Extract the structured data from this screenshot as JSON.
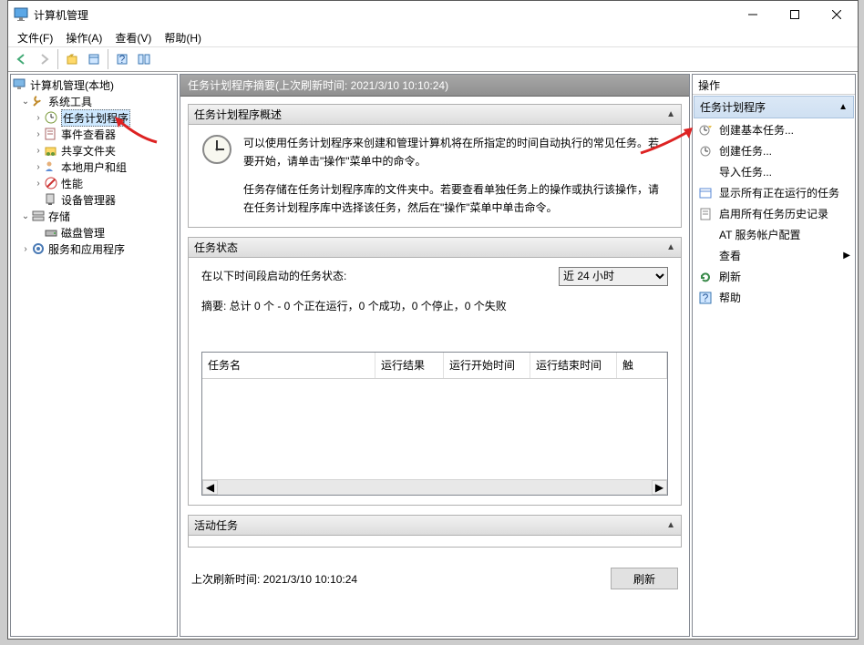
{
  "window": {
    "title": "计算机管理"
  },
  "menu": {
    "file": "文件(F)",
    "action": "操作(A)",
    "view": "查看(V)",
    "help": "帮助(H)"
  },
  "tree": {
    "root": "计算机管理(本地)",
    "system_tools": "系统工具",
    "task_scheduler": "任务计划程序",
    "event_viewer": "事件查看器",
    "shared_folders": "共享文件夹",
    "local_users": "本地用户和组",
    "performance": "性能",
    "device_manager": "设备管理器",
    "storage": "存储",
    "disk_management": "磁盘管理",
    "services_apps": "服务和应用程序"
  },
  "main": {
    "header": "任务计划程序摘要(上次刷新时间: 2021/3/10 10:10:24)",
    "overview_title": "任务计划程序概述",
    "overview_p1": "可以使用任务计划程序来创建和管理计算机将在所指定的时间自动执行的常见任务。若要开始，请单击\"操作\"菜单中的命令。",
    "overview_p2": "任务存储在任务计划程序库的文件夹中。若要查看单独任务上的操作或执行该操作，请在任务计划程序库中选择该任务，然后在\"操作\"菜单中单击命令。",
    "status_title": "任务状态",
    "status_label": "在以下时间段启动的任务状态:",
    "status_period": "近 24 小时",
    "status_summary": "摘要: 总计 0 个 - 0 个正在运行，0 个成功，0 个停止，0 个失败",
    "col_name": "任务名",
    "col_result": "运行结果",
    "col_start": "运行开始时间",
    "col_end": "运行结束时间",
    "col_trigger": "触",
    "active_title": "活动任务",
    "last_refresh": "上次刷新时间: 2021/3/10 10:10:24",
    "refresh_btn": "刷新"
  },
  "actions": {
    "header": "操作",
    "section": "任务计划程序",
    "create_basic": "创建基本任务...",
    "create": "创建任务...",
    "import": "导入任务...",
    "show_running": "显示所有正在运行的任务",
    "enable_history": "启用所有任务历史记录",
    "at_account": "AT 服务帐户配置",
    "view": "查看",
    "refresh": "刷新",
    "help": "帮助"
  }
}
